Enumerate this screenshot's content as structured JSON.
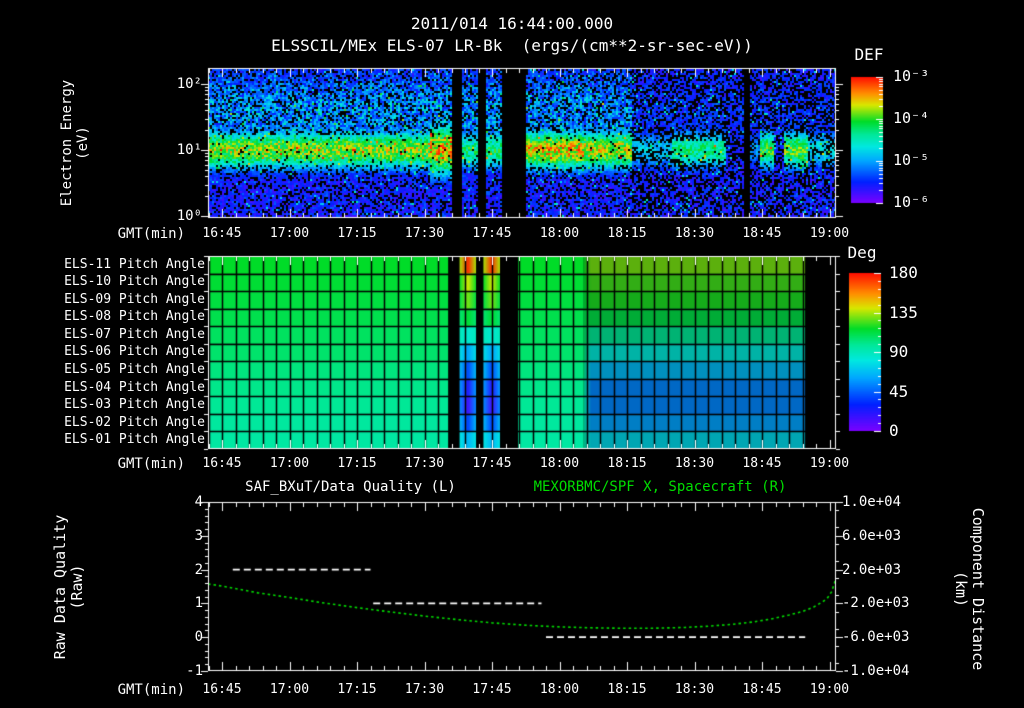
{
  "title": {
    "datetime": "2011/014 16:44:00.000",
    "instrument": "ELSSCIL/MEx ELS-07 LR-Bk  (ergs/(cm**2-sr-sec-eV))"
  },
  "time_axis": {
    "label": "GMT(min)",
    "ticks": [
      "16:45",
      "17:00",
      "17:15",
      "17:30",
      "17:45",
      "18:00",
      "18:15",
      "18:30",
      "18:45",
      "19:00"
    ]
  },
  "spectrogram_panel": {
    "ylabel_line1": "Electron Energy",
    "ylabel_line2": "(eV)",
    "yticks": [
      "10²",
      "10¹",
      "10⁰"
    ],
    "colorbar_title": "DEF",
    "colorbar_ticks": [
      "10⁻³",
      "10⁻⁴",
      "10⁻⁵",
      "10⁻⁶"
    ]
  },
  "pitch_panel": {
    "colorbar_title": "Deg",
    "colorbar_ticks": [
      "180",
      "135",
      "90",
      "45",
      "0"
    ]
  },
  "bottom_panel": {
    "title_left": "SAF_BXuT/Data Quality (L)",
    "title_right": "MEXORBMC/SPF X, Spacecraft (R)",
    "title_right_color": "#00dd00",
    "ylabel_left_line1": "Raw Data Quality",
    "ylabel_left_line2": "(Raw)",
    "yticks_left": [
      "4",
      "3",
      "2",
      "1",
      "0",
      "-1"
    ],
    "ylabel_right_line1": "Component Distance",
    "ylabel_right_line2": "(km)",
    "yticks_right": [
      "1.0e+04",
      "6.0e+03",
      "2.0e+03",
      "-2.0e+03",
      "-6.0e+03",
      "-1.0e+04"
    ]
  },
  "chart_data": [
    {
      "type": "heatmap",
      "name": "electron-energy-spectrogram",
      "title": "ELSSCIL/MEx ELS-07 LR-Bk",
      "z_units": "ergs/(cm**2-sr-sec-eV)",
      "x_axis": {
        "label": "GMT(min)",
        "start": "16:45",
        "end": "19:00",
        "major_tick_min": 15,
        "minor_tick_min": 3
      },
      "y_axis": {
        "label": "Electron Energy (eV)",
        "scale": "log",
        "decade_ticks": [
          100,
          10,
          1
        ]
      },
      "colorbar": {
        "title": "DEF",
        "min": 1e-06,
        "max": 0.001
      },
      "colormap_stops": [
        [
          0,
          "#7d00ff"
        ],
        [
          0.17,
          "#0020ff"
        ],
        [
          0.34,
          "#00a8ff"
        ],
        [
          0.45,
          "#00e8e0"
        ],
        [
          0.55,
          "#00e896"
        ],
        [
          0.65,
          "#00dc28"
        ],
        [
          0.78,
          "#d8e800"
        ],
        [
          0.87,
          "#ff9000"
        ],
        [
          1,
          "#ff1000"
        ]
      ],
      "band_center_ev": 10,
      "time_segments_min_after_1645": [
        {
          "t0": -3.2,
          "t1": 46,
          "peak": 0.7
        },
        {
          "t0": 46,
          "t1": 51,
          "peak": 0.8,
          "wide": true
        },
        {
          "t0": 51,
          "t1": 53.2,
          "peak": 0,
          "gap": true
        },
        {
          "t0": 53.2,
          "t1": 56.6,
          "peak": 0.55
        },
        {
          "t0": 56.6,
          "t1": 58.6,
          "peak": 0,
          "gap": true
        },
        {
          "t0": 58.6,
          "t1": 62,
          "peak": 0.58
        },
        {
          "t0": 62,
          "t1": 67.5,
          "peak": 0,
          "gap": true
        },
        {
          "t0": 67.5,
          "t1": 80,
          "peak": 0.8
        },
        {
          "t0": 80,
          "t1": 91,
          "peak": 0.74
        },
        {
          "t0": 91,
          "t1": 100,
          "peak": 0.38,
          "sparse": true
        },
        {
          "t0": 100,
          "t1": 112,
          "peak": 0.55,
          "sparse": true
        },
        {
          "t0": 112,
          "t1": 115.6,
          "peak": 0.12,
          "sparse": true
        },
        {
          "t0": 115.6,
          "t1": 117.3,
          "peak": 0,
          "gap": true
        },
        {
          "t0": 117.3,
          "t1": 119.5,
          "peak": 0.3,
          "sparse": true
        },
        {
          "t0": 119.5,
          "t1": 122.5,
          "peak": 0.62,
          "sparse": true
        },
        {
          "t0": 122.5,
          "t1": 124.5,
          "peak": 0.12,
          "sparse": true
        },
        {
          "t0": 124.5,
          "t1": 130,
          "peak": 0.66,
          "sparse": true
        },
        {
          "t0": 130,
          "t1": 136.5,
          "peak": 0.42,
          "sparse": true
        }
      ]
    },
    {
      "type": "heatmap",
      "name": "pitch-angle-panels",
      "rows": [
        "ELS-11 Pitch Angle",
        "ELS-10 Pitch Angle",
        "ELS-09 Pitch Angle",
        "ELS-08 Pitch Angle",
        "ELS-07 Pitch Angle",
        "ELS-06 Pitch Angle",
        "ELS-05 Pitch Angle",
        "ELS-04 Pitch Angle",
        "ELS-03 Pitch Angle",
        "ELS-02 Pitch Angle",
        "ELS-01 Pitch Angle"
      ],
      "colorbar": {
        "title": "Deg",
        "min": 0,
        "max": 180,
        "ticks": [
          180,
          135,
          90,
          45,
          0
        ]
      },
      "column_width_min": 3,
      "row_deg_quiet": [
        117,
        115,
        113,
        111,
        108,
        106,
        103,
        101,
        99,
        97,
        96
      ],
      "row_deg_after_1805": [
        130,
        124,
        120,
        112,
        99,
        83,
        67,
        54,
        54,
        60,
        76
      ],
      "row_deg_eclipse_columns": [
        175,
        140,
        130,
        115,
        85,
        60,
        40,
        22,
        15,
        38,
        65
      ],
      "time_segments_min_after_1645": [
        {
          "type": "quiet",
          "t0": -3.2,
          "t1": 50.3
        },
        {
          "type": "gap",
          "t0": 50.3,
          "t1": 52.8
        },
        {
          "type": "stripe",
          "t0": 52.8,
          "t1": 56.5
        },
        {
          "type": "gap",
          "t0": 56.5,
          "t1": 58.1
        },
        {
          "type": "stripe",
          "t0": 58.1,
          "t1": 61.8
        },
        {
          "type": "gap",
          "t0": 61.8,
          "t1": 65.8
        },
        {
          "type": "quiet",
          "t0": 65.8,
          "t1": 80.3
        },
        {
          "type": "disturbed",
          "t0": 80.3,
          "t1": 129.6,
          "blend_min": 1.6
        },
        {
          "type": "gap",
          "t0": 129.6,
          "t1": 136.5
        }
      ]
    },
    {
      "type": "line",
      "name": "raw-data-quality",
      "title": "SAF_BXuT/Data Quality (L)",
      "axis": "left",
      "style": "dashed",
      "color": "#ffffff",
      "y_range": [
        -1,
        4
      ],
      "segments": [
        {
          "value": 2,
          "t0": 2.4,
          "t1": 33
        },
        {
          "value": 1,
          "t0": 33.6,
          "t1": 71
        },
        {
          "value": 0,
          "t0": 72,
          "t1": 129.6
        }
      ]
    },
    {
      "type": "line",
      "name": "spacecraft-x-component",
      "title": "MEXORBMC/SPF X, Spacecraft (R)",
      "axis": "right",
      "style": "dotted",
      "color": "#00dd00",
      "y_range_km": [
        -10000,
        10000
      ],
      "points_t_km": [
        [
          -3.1,
          300
        ],
        [
          0,
          50
        ],
        [
          8,
          -750
        ],
        [
          15,
          -1300
        ],
        [
          22,
          -1900
        ],
        [
          30,
          -2500
        ],
        [
          38,
          -3050
        ],
        [
          45,
          -3500
        ],
        [
          52,
          -3900
        ],
        [
          60,
          -4300
        ],
        [
          68,
          -4600
        ],
        [
          75,
          -4780
        ],
        [
          82,
          -4890
        ],
        [
          90,
          -4950
        ],
        [
          97,
          -4930
        ],
        [
          103,
          -4840
        ],
        [
          108,
          -4700
        ],
        [
          113,
          -4500
        ],
        [
          118,
          -4200
        ],
        [
          122,
          -3850
        ],
        [
          126,
          -3380
        ],
        [
          129,
          -2950
        ],
        [
          131.5,
          -2430
        ],
        [
          133.5,
          -1800
        ],
        [
          134.5,
          -1400
        ],
        [
          135.5,
          -600
        ],
        [
          136.4,
          900
        ]
      ]
    }
  ]
}
